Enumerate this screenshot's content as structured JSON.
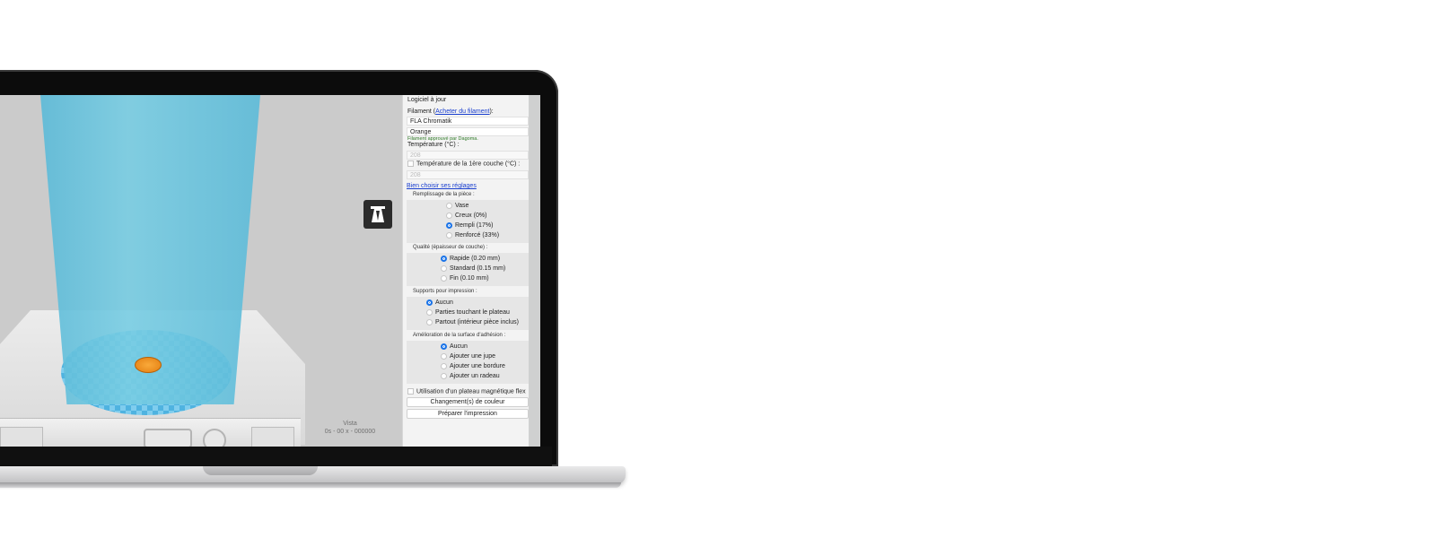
{
  "status": "Logiciel à jour",
  "filament": {
    "label": "Filament",
    "link_open": "(",
    "link": "Acheter du filament",
    "link_close": "):",
    "value": "FLA Chromatik",
    "color_value": "Orange",
    "approved_note": "Filament approuvé par Dagoma."
  },
  "temperature": {
    "label": "Température (°C) :",
    "value": "208"
  },
  "first_layer": {
    "label": "Température de la 1ère couche  (°C) :",
    "value": "208"
  },
  "help_link": "Bien choisir ses réglages",
  "fill": {
    "title": "Remplissage de la pièce :",
    "options": [
      {
        "label": "Vase",
        "selected": false
      },
      {
        "label": "Creux (0%)",
        "selected": false
      },
      {
        "label": "Rempli (17%)",
        "selected": true
      },
      {
        "label": "Renforcé (33%)",
        "selected": false
      }
    ]
  },
  "quality": {
    "title": "Qualité (épaisseur de couche) :",
    "options": [
      {
        "label": "Rapide (0.20 mm)",
        "selected": true
      },
      {
        "label": "Standard (0.15 mm)",
        "selected": false
      },
      {
        "label": "Fin (0.10 mm)",
        "selected": false
      }
    ]
  },
  "supports": {
    "title": "Supports pour impression :",
    "options": [
      {
        "label": "Aucun",
        "selected": true
      },
      {
        "label": "Parties touchant le plateau",
        "selected": false
      },
      {
        "label": "Partout (intérieur pièce inclus)",
        "selected": false
      }
    ]
  },
  "adhesion": {
    "title": "Amélioration de la surface d'adhésion :",
    "options": [
      {
        "label": "Aucun",
        "selected": true
      },
      {
        "label": "Ajouter une jupe",
        "selected": false
      },
      {
        "label": "Ajouter une bordure",
        "selected": false
      },
      {
        "label": "Ajouter un radeau",
        "selected": false
      }
    ]
  },
  "magnetic": "Utilisation d'un plateau magnétique flex",
  "color_change_button": "Changement(s) de couleur",
  "prepare_button": "Préparer l'impression",
  "viewport_info": {
    "line1": "Vista",
    "line2": "0s - 00 x - 000000"
  },
  "colors": {
    "accent": "#1b74e8",
    "beam": "#5bbad8",
    "model": "#f29a26"
  },
  "icons": {
    "logo": "dagoma-logo-icon"
  }
}
